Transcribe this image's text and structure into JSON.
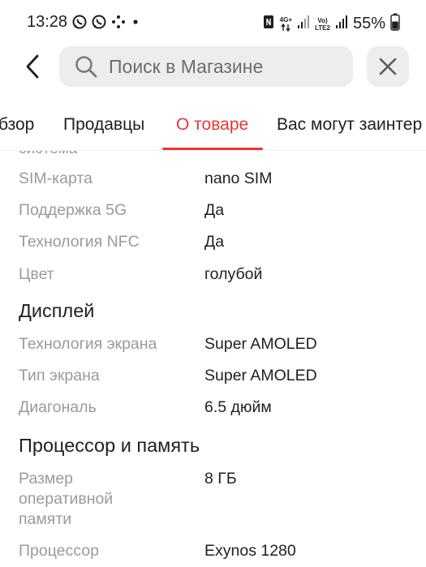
{
  "status_bar": {
    "time": "13:28",
    "left_icons": [
      "whatsapp-icon",
      "whatsapp-icon",
      "app-dots-icon",
      "dot-icon"
    ],
    "right_icons": [
      "nfc-icon",
      "network-4g-icon",
      "signal-icon",
      "volte-lte2-icon",
      "signal-icon",
      "battery-icon"
    ],
    "network_4g_label": "4G+",
    "volte_label_top": "Vo)",
    "volte_label_bottom": "LTE2",
    "battery_percent": "55%"
  },
  "header": {
    "search_placeholder": "Поиск в Магазине",
    "search_value": ""
  },
  "tabs": [
    {
      "label": "бзор",
      "active": false
    },
    {
      "label": "Продавцы",
      "active": false
    },
    {
      "label": "О товаре",
      "active": true
    },
    {
      "label": "Вас могут заинтер",
      "active": false
    }
  ],
  "specs": {
    "cut_off_label": "система",
    "general_rows": [
      {
        "label": "SIM-карта",
        "value": "nano SIM"
      },
      {
        "label": "Поддержка 5G",
        "value": "Да"
      },
      {
        "label": "Технология NFC",
        "value": "Да"
      },
      {
        "label": "Цвет",
        "value": "голубой"
      }
    ],
    "display_title": "Дисплей",
    "display_rows": [
      {
        "label": "Технология экрана",
        "value": "Super AMOLED"
      },
      {
        "label": "Тип экрана",
        "value": "Super AMOLED"
      },
      {
        "label": "Диагональ",
        "value": "6.5 дюйм"
      }
    ],
    "cpu_title": "Процессор и память",
    "cpu_rows": [
      {
        "label": "Размер\nоперативной\nпамяти",
        "value": "8 ГБ"
      },
      {
        "label": "Процессор",
        "value": "Exynos 1280"
      }
    ]
  },
  "colors": {
    "accent": "#e53935",
    "label_gray": "#9a9a9a",
    "text_dark": "#1f1f1f",
    "search_bg": "#ededed"
  }
}
